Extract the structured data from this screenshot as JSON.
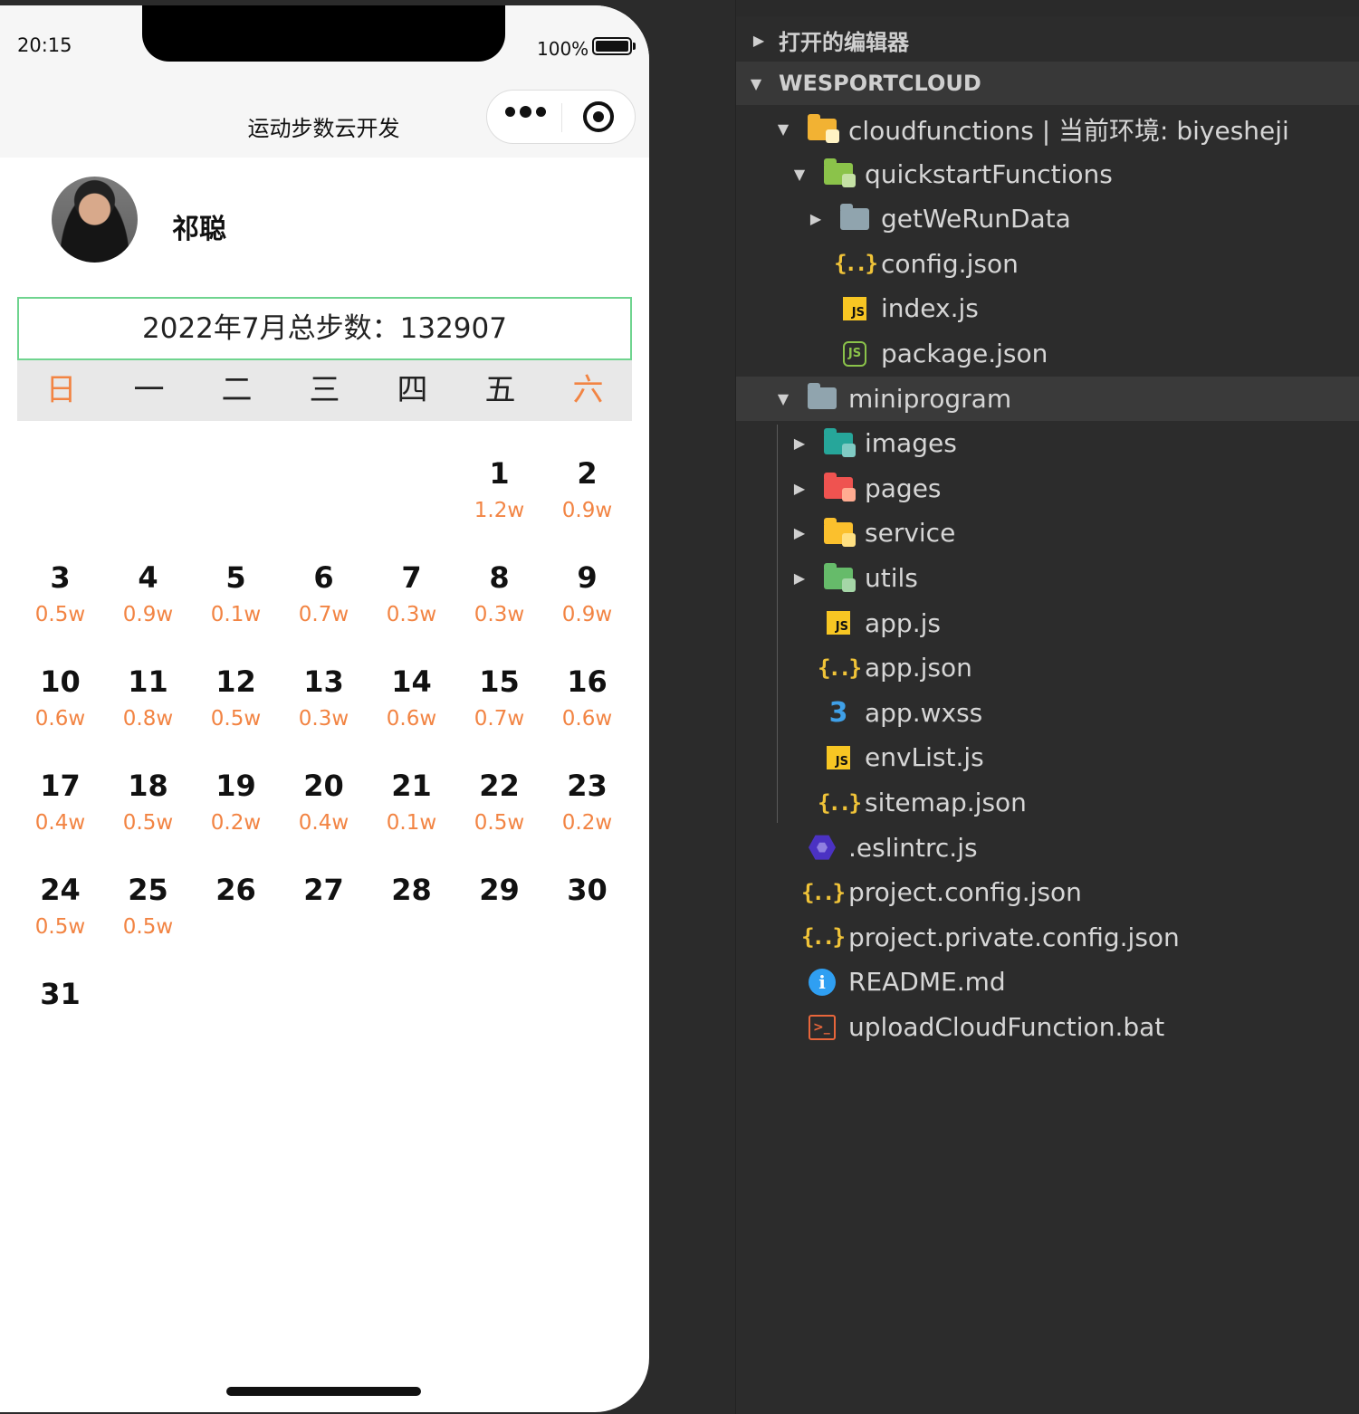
{
  "status_bar": {
    "time": "20:15",
    "battery": "100%"
  },
  "nav": {
    "title": "运动步数云开发"
  },
  "user": {
    "name": "祁聪"
  },
  "summary": {
    "total_text": "2022年7月总步数：132907"
  },
  "calendar": {
    "weekdays": [
      "日",
      "一",
      "二",
      "三",
      "四",
      "五",
      "六"
    ],
    "weeks": [
      [
        {
          "day": "",
          "steps": ""
        },
        {
          "day": "",
          "steps": ""
        },
        {
          "day": "",
          "steps": ""
        },
        {
          "day": "",
          "steps": ""
        },
        {
          "day": "",
          "steps": ""
        },
        {
          "day": "1",
          "steps": "1.2w"
        },
        {
          "day": "2",
          "steps": "0.9w"
        }
      ],
      [
        {
          "day": "3",
          "steps": "0.5w"
        },
        {
          "day": "4",
          "steps": "0.9w"
        },
        {
          "day": "5",
          "steps": "0.1w"
        },
        {
          "day": "6",
          "steps": "0.7w"
        },
        {
          "day": "7",
          "steps": "0.3w"
        },
        {
          "day": "8",
          "steps": "0.3w"
        },
        {
          "day": "9",
          "steps": "0.9w"
        }
      ],
      [
        {
          "day": "10",
          "steps": "0.6w"
        },
        {
          "day": "11",
          "steps": "0.8w"
        },
        {
          "day": "12",
          "steps": "0.5w"
        },
        {
          "day": "13",
          "steps": "0.3w"
        },
        {
          "day": "14",
          "steps": "0.6w"
        },
        {
          "day": "15",
          "steps": "0.7w"
        },
        {
          "day": "16",
          "steps": "0.6w"
        }
      ],
      [
        {
          "day": "17",
          "steps": "0.4w"
        },
        {
          "day": "18",
          "steps": "0.5w"
        },
        {
          "day": "19",
          "steps": "0.2w"
        },
        {
          "day": "20",
          "steps": "0.4w"
        },
        {
          "day": "21",
          "steps": "0.1w"
        },
        {
          "day": "22",
          "steps": "0.5w"
        },
        {
          "day": "23",
          "steps": "0.2w"
        }
      ],
      [
        {
          "day": "24",
          "steps": "0.5w"
        },
        {
          "day": "25",
          "steps": "0.5w"
        },
        {
          "day": "26",
          "steps": ""
        },
        {
          "day": "27",
          "steps": ""
        },
        {
          "day": "28",
          "steps": ""
        },
        {
          "day": "29",
          "steps": ""
        },
        {
          "day": "30",
          "steps": ""
        }
      ],
      [
        {
          "day": "31",
          "steps": ""
        }
      ]
    ]
  },
  "explorer": {
    "sections": [
      {
        "label": "打开的编辑器",
        "expanded": false
      },
      {
        "label": "WESPORTCLOUD",
        "expanded": true
      }
    ],
    "tree": [
      {
        "label": "cloudfunctions | 当前环境: biyesheji",
        "icon": "cloud-folder-icon",
        "caret": "▼",
        "indent": 0
      },
      {
        "label": "quickstartFunctions",
        "icon": "function-folder-icon",
        "caret": "▼",
        "indent": 1
      },
      {
        "label": "getWeRunData",
        "icon": "folder-icon",
        "caret": "▶",
        "indent": 2
      },
      {
        "label": "config.json",
        "icon": "json-icon",
        "caret": "",
        "indent": 2
      },
      {
        "label": "index.js",
        "icon": "js-icon",
        "caret": "",
        "indent": 2
      },
      {
        "label": "package.json",
        "icon": "nodejs-icon",
        "caret": "",
        "indent": 2
      },
      {
        "label": "miniprogram",
        "icon": "open-folder-icon",
        "caret": "▼",
        "indent": 0,
        "selected": true
      },
      {
        "label": "images",
        "icon": "images-folder-icon",
        "caret": "▶",
        "indent": 1
      },
      {
        "label": "pages",
        "icon": "pages-folder-icon",
        "caret": "▶",
        "indent": 1
      },
      {
        "label": "service",
        "icon": "service-folder-icon",
        "caret": "▶",
        "indent": 1
      },
      {
        "label": "utils",
        "icon": "utils-folder-icon",
        "caret": "▶",
        "indent": 1
      },
      {
        "label": "app.js",
        "icon": "js-icon",
        "caret": "",
        "indent": 1
      },
      {
        "label": "app.json",
        "icon": "json-icon",
        "caret": "",
        "indent": 1
      },
      {
        "label": "app.wxss",
        "icon": "css-icon",
        "caret": "",
        "indent": 1
      },
      {
        "label": "envList.js",
        "icon": "js-icon",
        "caret": "",
        "indent": 1
      },
      {
        "label": "sitemap.json",
        "icon": "json-icon",
        "caret": "",
        "indent": 1
      },
      {
        "label": ".eslintrc.js",
        "icon": "eslint-icon",
        "caret": "",
        "indent": 0
      },
      {
        "label": "project.config.json",
        "icon": "json-icon",
        "caret": "",
        "indent": 0
      },
      {
        "label": "project.private.config.json",
        "icon": "json-icon",
        "caret": "",
        "indent": 0
      },
      {
        "label": "README.md",
        "icon": "info-icon",
        "caret": "",
        "indent": 0
      },
      {
        "label": "uploadCloudFunction.bat",
        "icon": "bat-icon",
        "caret": "",
        "indent": 0
      }
    ]
  },
  "colors": {
    "accent_orange": "#f28443",
    "border_green": "#6fd48f",
    "explorer_bg": "#2c2c2c"
  }
}
